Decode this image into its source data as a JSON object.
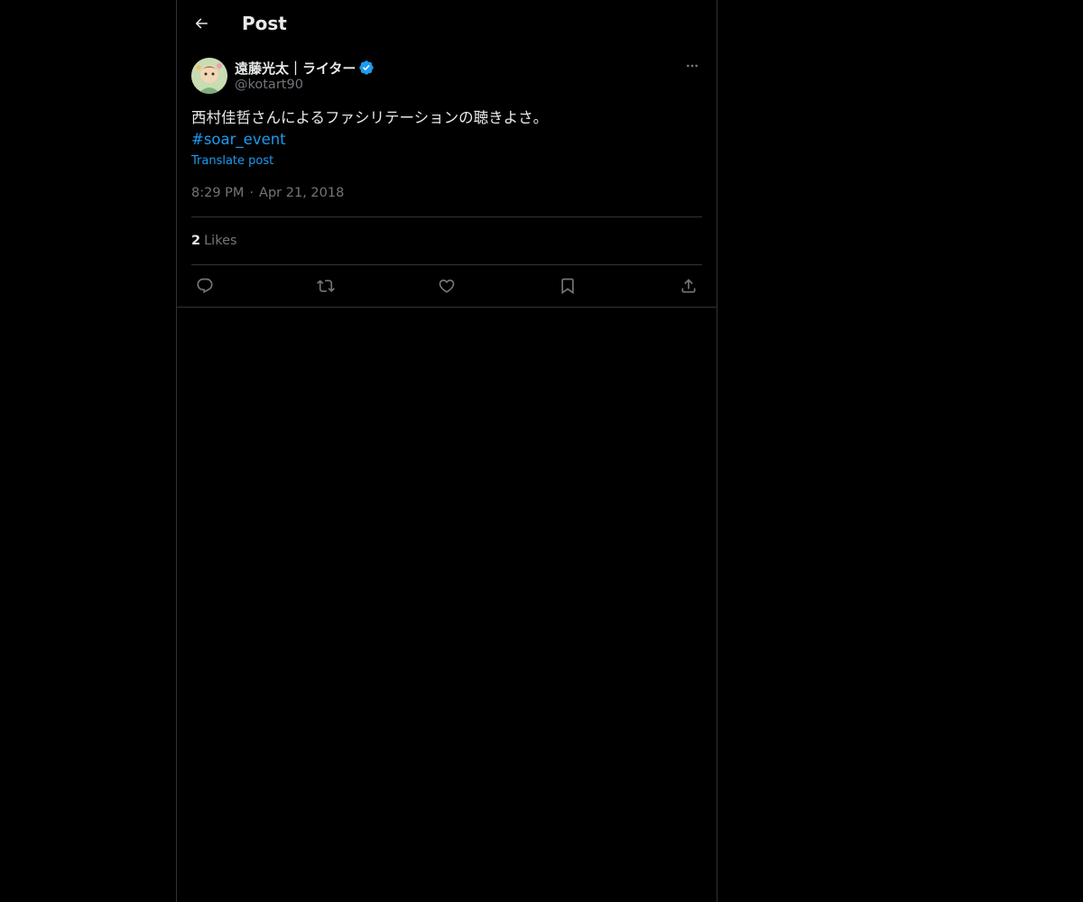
{
  "header": {
    "title": "Post",
    "back_icon": "arrow-left-icon"
  },
  "post": {
    "author": {
      "display_name": "遠藤光太｜ライター",
      "handle": "@kotart90",
      "verified": true,
      "verified_color": "#1d9bf0"
    },
    "text": "西村佳哲さんによるファシリテーションの聴きよさ。",
    "hashtag": "#soar_event",
    "translate_label": "Translate post",
    "time": "8:29 PM",
    "separator": "·",
    "date": "Apr 21, 2018",
    "likes": {
      "count": "2",
      "label": "Likes"
    },
    "actions": [
      {
        "name": "reply",
        "icon": "reply-icon"
      },
      {
        "name": "repost",
        "icon": "repost-icon"
      },
      {
        "name": "like",
        "icon": "heart-icon"
      },
      {
        "name": "bookmark",
        "icon": "bookmark-icon"
      },
      {
        "name": "share",
        "icon": "share-icon"
      }
    ]
  },
  "colors": {
    "background": "#000000",
    "text_primary": "#e7e9ea",
    "text_secondary": "#71767b",
    "accent": "#1d9bf0",
    "border": "#2f3336"
  }
}
